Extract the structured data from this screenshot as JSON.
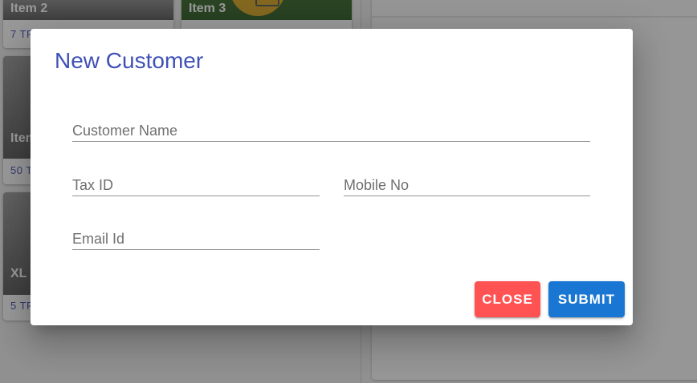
{
  "background": {
    "items": [
      {
        "name": "Item 2",
        "qty": "7 TR"
      },
      {
        "name": "Item 3"
      },
      {
        "name": "Item",
        "qty": "50 T"
      },
      {
        "name": "XL i",
        "qty": "5 TR"
      }
    ]
  },
  "dialog": {
    "title": "New Customer",
    "fields": {
      "customer_name": {
        "placeholder": "Customer Name",
        "value": ""
      },
      "tax_id": {
        "placeholder": "Tax ID",
        "value": ""
      },
      "mobile_no": {
        "placeholder": "Mobile No",
        "value": ""
      },
      "email_id": {
        "placeholder": "Email Id",
        "value": ""
      }
    },
    "buttons": {
      "close_label": "CLOSE",
      "submit_label": "SUBMIT"
    }
  },
  "colors": {
    "title": "#3f51b5",
    "close_button": "#ff5252",
    "submit_button": "#1976d2",
    "qty_text": "#3f51b5"
  }
}
